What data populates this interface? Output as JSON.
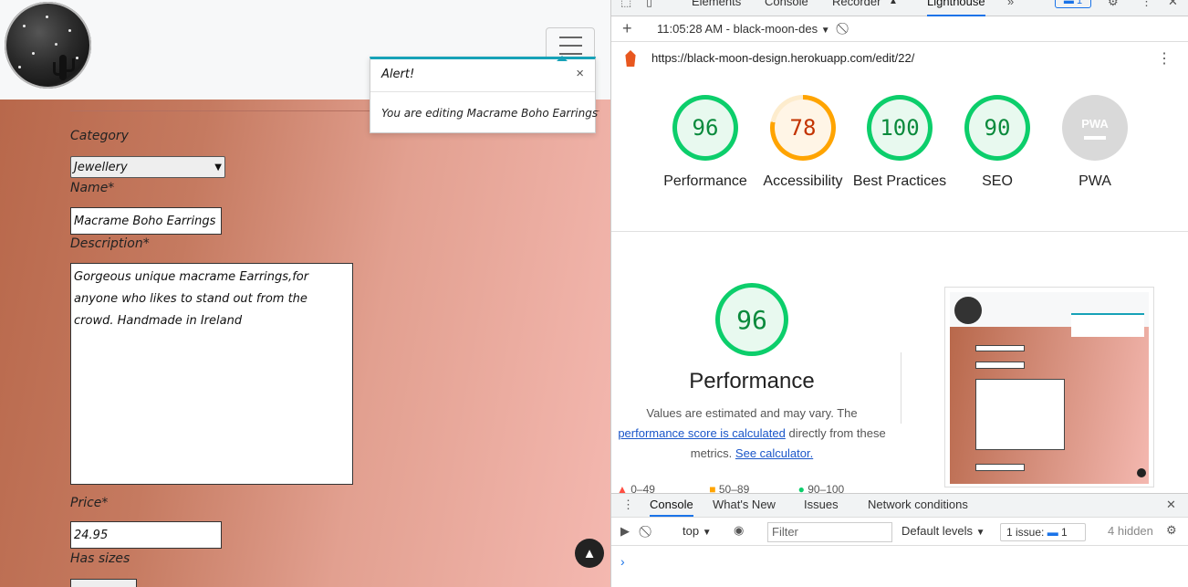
{
  "site": {
    "alert": {
      "title": "Alert!",
      "close": "×",
      "message": "You are editing Macrame Boho Earrings"
    },
    "form": {
      "category_label": "Category",
      "category_value": "Jewellery",
      "name_label": "Name*",
      "name_value": "Macrame Boho Earrings",
      "description_label": "Description*",
      "description_value": "Gorgeous unique macrame Earrings,for anyone who likes to stand out from the crowd. Handmade in Ireland",
      "price_label": "Price*",
      "price_value": "24.95",
      "sizes_label": "Has sizes"
    }
  },
  "devtools": {
    "tabs": [
      "Elements",
      "Console",
      "Recorder",
      "Lighthouse"
    ],
    "active_tab": "Lighthouse",
    "issues_count": "1",
    "report_time": "11:05:28 AM - black-moon-des",
    "url": "https://black-moon-design.herokuapp.com/edit/22/",
    "scores": [
      {
        "label": "Performance",
        "value": "96"
      },
      {
        "label": "Accessibility",
        "value": "78"
      },
      {
        "label": "Best Practices",
        "value": "100"
      },
      {
        "label": "SEO",
        "value": "90"
      },
      {
        "label": "PWA",
        "value": "PWA"
      }
    ],
    "performance": {
      "score": "96",
      "title": "Performance",
      "note_prefix": "Values are estimated and may vary. The",
      "note_link1": "performance score is calculated",
      "note_mid": "directly from these metrics.",
      "note_link2": "See calculator."
    },
    "legend": {
      "range_low": "0–49",
      "range_mid": "50–89",
      "range_high": "90–100"
    },
    "drawer": {
      "tabs": [
        "Console",
        "What's New",
        "Issues",
        "Network conditions"
      ],
      "context": "top",
      "filter_placeholder": "Filter",
      "levels": "Default levels",
      "issue_label": "1 issue:",
      "issue_count": "1",
      "hidden": "4 hidden"
    },
    "colors": {
      "pass": "#0cce6b",
      "average": "#ffa400",
      "fail": "#ff4e42",
      "link": "#1a56c9",
      "accent": "#1a73e8"
    }
  }
}
